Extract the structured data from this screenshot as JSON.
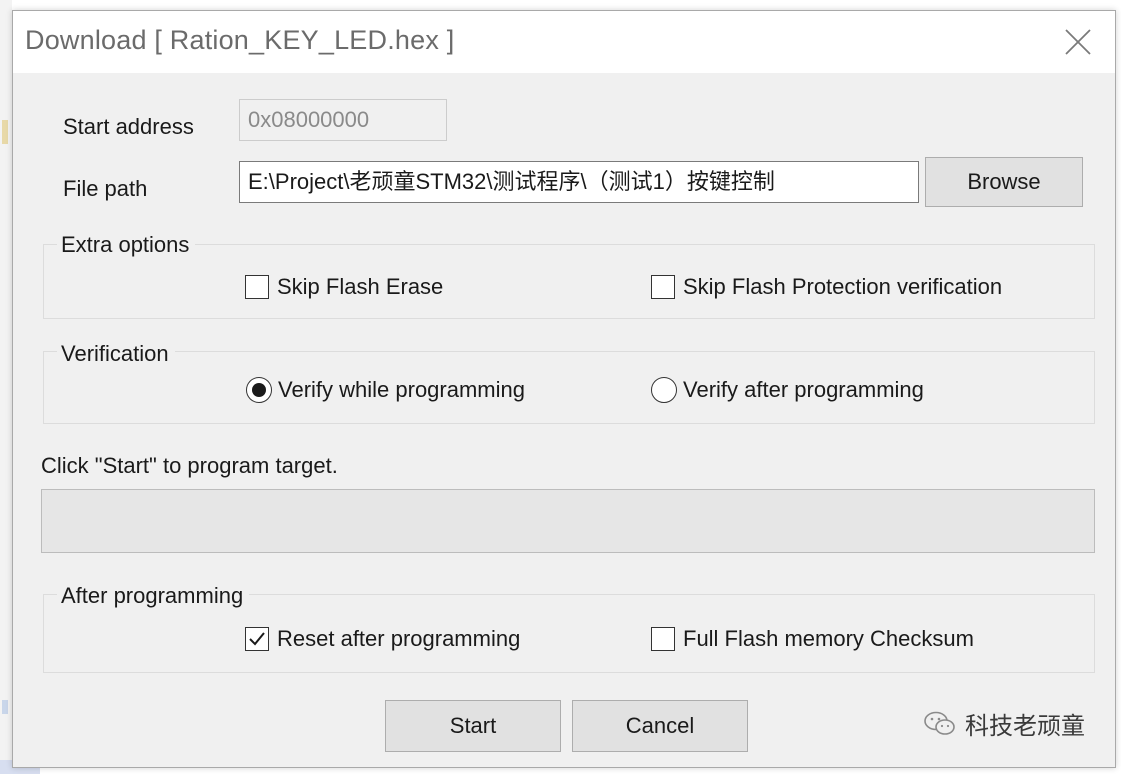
{
  "window": {
    "title": "Download [ Ration_KEY_LED.hex ]",
    "close_icon": "close-icon"
  },
  "fields": {
    "start_address_label": "Start address",
    "start_address_value": "0x08000000",
    "file_path_label": "File path",
    "file_path_value": "E:\\Project\\老顽童STM32\\测试程序\\（测试1）按键控制",
    "browse_label": "Browse"
  },
  "extra_options": {
    "title": "Extra options",
    "skip_flash_erase": {
      "label": "Skip Flash Erase",
      "checked": false
    },
    "skip_flash_protection": {
      "label": "Skip Flash Protection verification",
      "checked": false
    }
  },
  "verification": {
    "title": "Verification",
    "verify_while": {
      "label": "Verify while programming",
      "selected": true
    },
    "verify_after": {
      "label": "Verify after programming",
      "selected": false
    }
  },
  "status": {
    "message": "Click \"Start\" to program target.",
    "progress": 0
  },
  "after_programming": {
    "title": "After programming",
    "reset_after": {
      "label": "Reset after programming",
      "checked": true
    },
    "full_checksum": {
      "label": "Full Flash memory Checksum",
      "checked": false
    }
  },
  "buttons": {
    "start_label": "Start",
    "cancel_label": "Cancel"
  },
  "watermark": {
    "text": "科技老顽童",
    "icon": "wechat-icon"
  },
  "colors": {
    "dialog_bg": "#f0f0f0",
    "button_bg": "#e1e1e1",
    "progress_fill": "#06b025"
  }
}
